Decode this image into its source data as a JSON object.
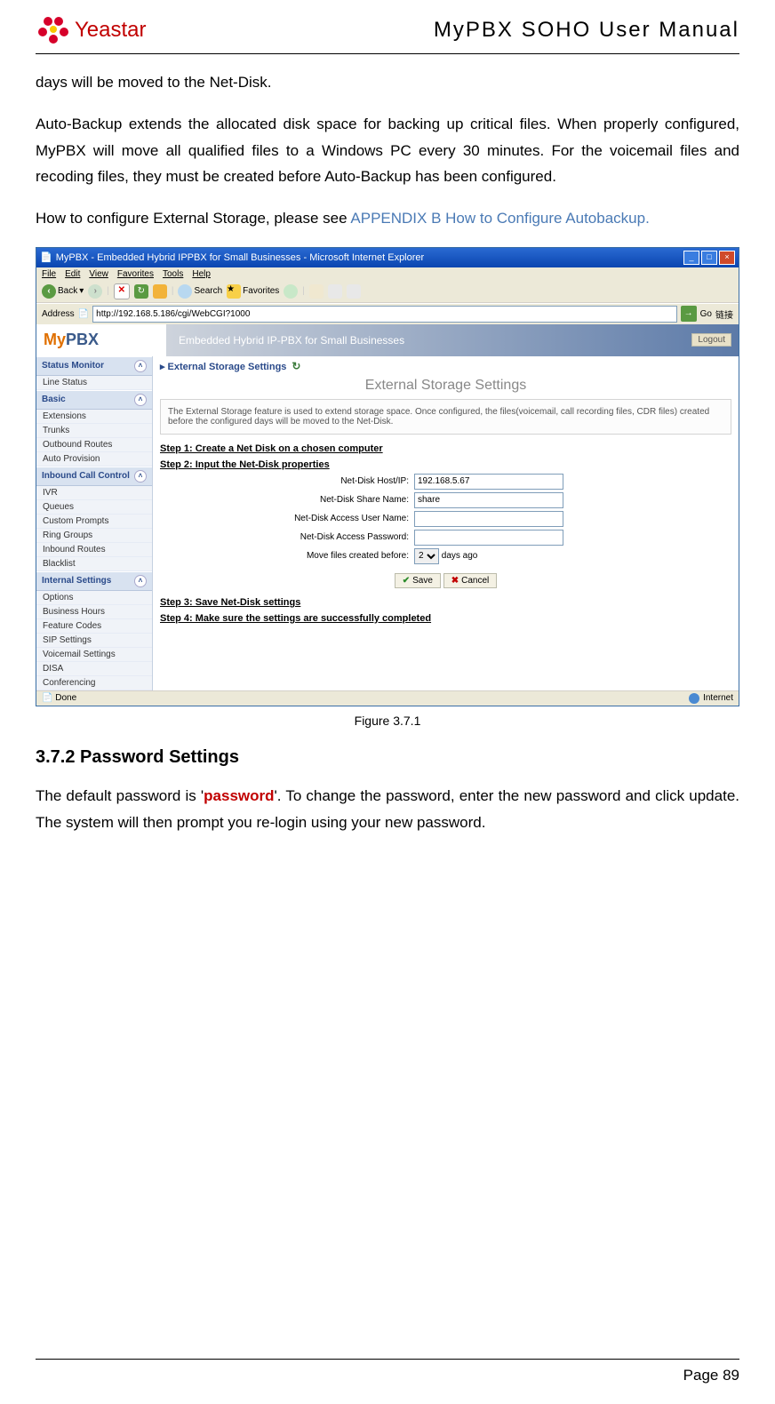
{
  "header": {
    "logo_text": "Yeastar",
    "doc_title": "MyPBX SOHO User Manual"
  },
  "intro": {
    "p1": "days will be moved to the Net-Disk.",
    "p2": "Auto-Backup extends the allocated disk space for backing up critical files. When properly configured, MyPBX will move all qualified files to a Windows PC every 30 minutes. For the voicemail files and recoding files, they must be created before Auto-Backup has been configured.",
    "p3_prefix": "How to configure External Storage, please see ",
    "p3_link": "APPENDIX B How to Configure Autobackup."
  },
  "screenshot": {
    "window_title": "MyPBX - Embedded Hybrid IPPBX for Small Businesses - Microsoft Internet Explorer",
    "menubar": [
      "File",
      "Edit",
      "View",
      "Favorites",
      "Tools",
      "Help"
    ],
    "toolbar": {
      "back": "Back",
      "search": "Search",
      "favorites": "Favorites"
    },
    "address_label": "Address",
    "address_value": "http://192.168.5.186/cgi/WebCGI?1000",
    "go_label": "Go",
    "links_label": "链接",
    "app": {
      "logo_my": "My",
      "logo_pbx": "PBX",
      "tagline": "Embedded Hybrid IP-PBX for Small Businesses",
      "logout": "Logout"
    },
    "sidebar": {
      "g1": {
        "title": "Status Monitor",
        "items": [
          "Line Status"
        ]
      },
      "g2": {
        "title": "Basic",
        "items": [
          "Extensions",
          "Trunks",
          "Outbound Routes",
          "Auto Provision"
        ]
      },
      "g3": {
        "title": "Inbound Call Control",
        "items": [
          "IVR",
          "Queues",
          "Custom Prompts",
          "Ring Groups",
          "Inbound Routes",
          "Blacklist"
        ]
      },
      "g4": {
        "title": "Internal Settings",
        "items": [
          "Options",
          "Business Hours",
          "Feature Codes",
          "SIP Settings",
          "Voicemail Settings",
          "DISA",
          "Conferencing"
        ]
      }
    },
    "main": {
      "crumb": "External Storage Settings",
      "panel_title": "External Storage Settings",
      "info": "The External Storage feature is used to extend storage space. Once configured, the files(voicemail, call recording files, CDR files) created before the configured days will be moved to the Net-Disk.",
      "step1": "Step 1: Create a Net Disk on a chosen computer",
      "step2": "Step 2: Input the Net-Disk properties",
      "labels": {
        "host": "Net-Disk Host/IP:",
        "share": "Net-Disk Share Name:",
        "user": "Net-Disk Access User Name:",
        "pass": "Net-Disk Access Password:",
        "move": "Move files created before:",
        "daysago": "days ago"
      },
      "values": {
        "host": "192.168.5.67",
        "share": "share",
        "user": "",
        "pass": "",
        "move_days": "2"
      },
      "save": "Save",
      "cancel": "Cancel",
      "step3": "Step 3: Save Net-Disk settings",
      "step4": "Step 4: Make sure the settings are successfully completed"
    },
    "statusbar": {
      "done": "Done",
      "internet": "Internet"
    }
  },
  "figure_caption": "Figure 3.7.1",
  "section_title": "3.7.2 Password Settings",
  "password_section": {
    "p_prefix": "The default password is '",
    "p_pw": "password",
    "p_suffix": "'. To change the password, enter the new password and click update. The system will then prompt you re-login using your new password."
  },
  "page_label": "Page 89"
}
